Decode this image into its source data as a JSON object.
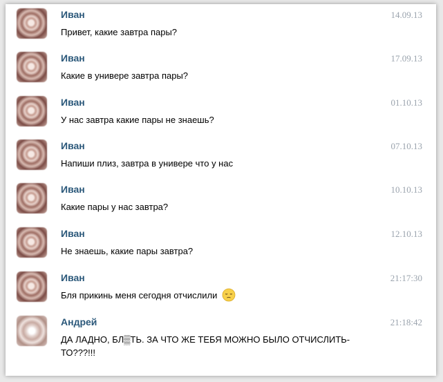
{
  "messages": [
    {
      "author": "Иван",
      "time": "14.09.13",
      "text": "Привет, какие завтра пары?"
    },
    {
      "author": "Иван",
      "time": "17.09.13",
      "text": "Какие в универе завтра пары?"
    },
    {
      "author": "Иван",
      "time": "01.10.13",
      "text": "У нас завтра какие пары не знаешь?"
    },
    {
      "author": "Иван",
      "time": "07.10.13",
      "text": "Напиши плиз, завтра в универе что у нас"
    },
    {
      "author": "Иван",
      "time": "10.10.13",
      "text": "Какие пары у нас завтра?"
    },
    {
      "author": "Иван",
      "time": "12.10.13",
      "text": "Не знаешь, какие пары завтра?"
    },
    {
      "author": "Иван",
      "time": "21:17:30",
      "text": "Бля прикинь меня сегодня отчислили",
      "emoji": "pensive-face-icon"
    },
    {
      "author": "Андрей",
      "time": "21:18:42",
      "text": "ДА ЛАДНО, БЛ▒ТЬ. ЗА ЧТО ЖЕ ТЕБЯ МОЖНО БЫЛО ОТЧИСЛИТЬ-ТО???!!!"
    }
  ],
  "colors": {
    "author_name": "#2b587a",
    "timestamp": "#9aa3ad",
    "text": "#000000"
  }
}
